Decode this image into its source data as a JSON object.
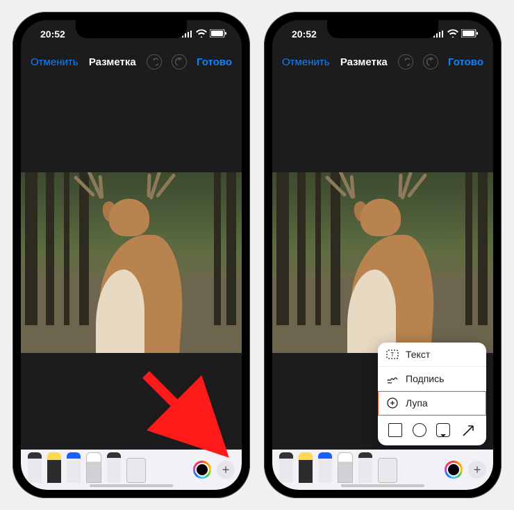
{
  "status": {
    "time": "20:52"
  },
  "nav": {
    "cancel": "Отменить",
    "title": "Разметка",
    "done": "Готово"
  },
  "popup": {
    "text": "Текст",
    "signature": "Подпись",
    "loupe": "Лупа"
  },
  "colors": {
    "accent": "#0a84ff",
    "arrow": "#ff1a1a",
    "highlight": "#e25b2f"
  },
  "tools": [
    "pen",
    "marker",
    "pencil",
    "eraser",
    "lasso",
    "ruler"
  ]
}
